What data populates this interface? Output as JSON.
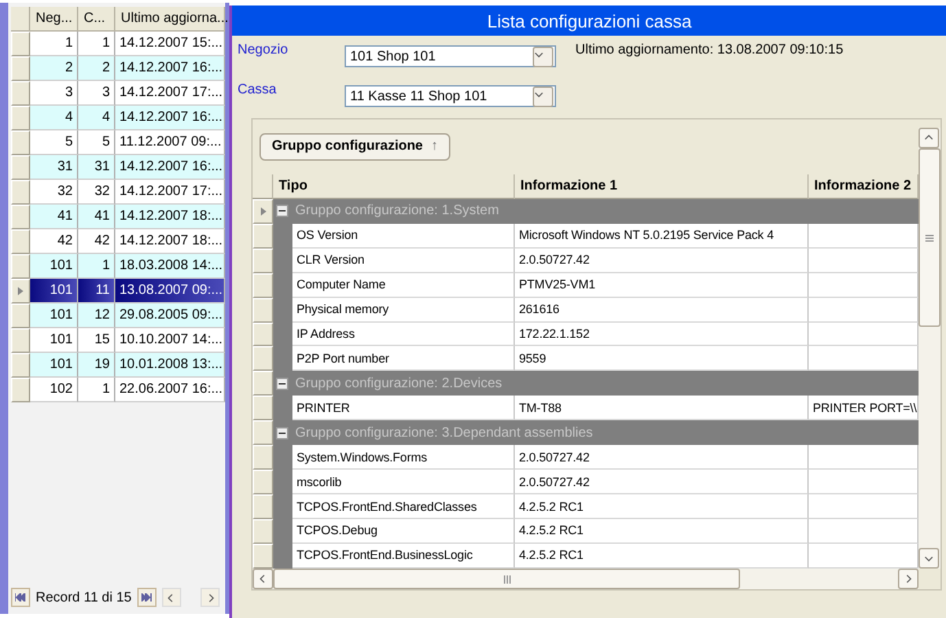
{
  "list": {
    "columns": [
      "Neg...",
      "C...",
      "Ultimo aggiorna..."
    ],
    "rows": [
      {
        "cells": [
          "1",
          "1",
          "14.12.2007 15:..."
        ],
        "selected": false
      },
      {
        "cells": [
          "2",
          "2",
          "14.12.2007 16:..."
        ],
        "selected": false
      },
      {
        "cells": [
          "3",
          "3",
          "14.12.2007 17:..."
        ],
        "selected": false
      },
      {
        "cells": [
          "4",
          "4",
          "14.12.2007 16:..."
        ],
        "selected": false
      },
      {
        "cells": [
          "5",
          "5",
          "11.12.2007 09:..."
        ],
        "selected": false
      },
      {
        "cells": [
          "31",
          "31",
          "14.12.2007 16:..."
        ],
        "selected": false
      },
      {
        "cells": [
          "32",
          "32",
          "14.12.2007 17:..."
        ],
        "selected": false
      },
      {
        "cells": [
          "41",
          "41",
          "14.12.2007 18:..."
        ],
        "selected": false
      },
      {
        "cells": [
          "42",
          "42",
          "14.12.2007 18:..."
        ],
        "selected": false
      },
      {
        "cells": [
          "101",
          "1",
          "18.03.2008 14:..."
        ],
        "selected": false
      },
      {
        "cells": [
          "101",
          "11",
          "13.08.2007 09:..."
        ],
        "selected": true
      },
      {
        "cells": [
          "101",
          "12",
          "29.08.2005 09:..."
        ],
        "selected": false
      },
      {
        "cells": [
          "101",
          "15",
          "10.10.2007 14:..."
        ],
        "selected": false
      },
      {
        "cells": [
          "101",
          "19",
          "10.01.2008 13:..."
        ],
        "selected": false
      },
      {
        "cells": [
          "102",
          "1",
          "22.06.2007 16:..."
        ],
        "selected": false
      }
    ],
    "navigator": "Record 11 di 15"
  },
  "panel": {
    "title": "Lista configurazioni cassa",
    "fields": [
      {
        "label": "Negozio",
        "value": "101 Shop 101"
      },
      {
        "label": "Cassa",
        "value": "11 Kasse 11 Shop 101"
      }
    ],
    "last_update": "Ultimo aggiornamento: 13.08.2007 09:10:15",
    "group_by": {
      "label": "Gruppo configurazione",
      "arrow": "↑"
    },
    "grid": {
      "columns": [
        "Tipo",
        "Informazione 1",
        "Informazione 2"
      ],
      "groups": [
        {
          "title": "Gruppo configurazione: 1.System",
          "expanded": true,
          "selected": true,
          "rows": [
            [
              "OS Version",
              "Microsoft Windows NT 5.0.2195 Service Pack 4",
              ""
            ],
            [
              "CLR Version",
              "2.0.50727.42",
              ""
            ],
            [
              "Computer Name",
              "PTMV25-VM1",
              ""
            ],
            [
              "Physical memory",
              "261616",
              ""
            ],
            [
              "IP Address",
              "172.22.1.152",
              ""
            ],
            [
              "P2P Port number",
              "9559",
              ""
            ]
          ]
        },
        {
          "title": "Gruppo configurazione: 2.Devices",
          "expanded": true,
          "selected": false,
          "rows": [
            [
              "PRINTER",
              "TM-T88",
              "PRINTER PORT=\\\\"
            ]
          ]
        },
        {
          "title": "Gruppo configurazione: 3.Dependant assemblies",
          "expanded": true,
          "selected": false,
          "rows": [
            [
              "System.Windows.Forms",
              "2.0.50727.42",
              ""
            ],
            [
              "mscorlib",
              "2.0.50727.42",
              ""
            ],
            [
              "TCPOS.FrontEnd.SharedClasses",
              "4.2.5.2 RC1",
              ""
            ],
            [
              "TCPOS.Debug",
              "4.2.5.2 RC1",
              ""
            ],
            [
              "TCPOS.FrontEnd.BusinessLogic",
              "4.2.5.2 RC1",
              ""
            ]
          ]
        }
      ]
    }
  }
}
